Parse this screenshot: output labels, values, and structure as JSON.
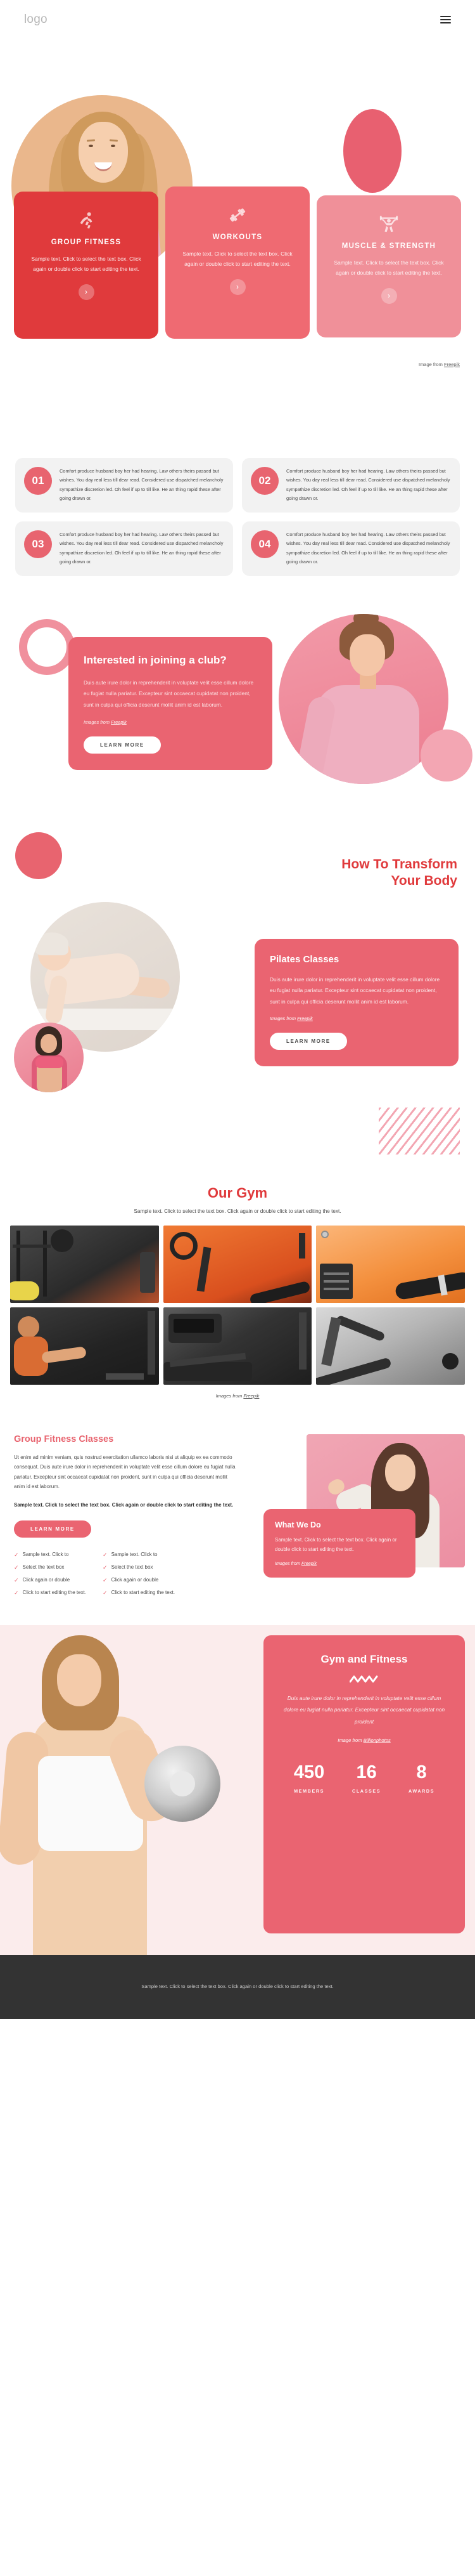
{
  "header": {
    "logo": "logo",
    "menu_icon": "hamburger-menu-icon"
  },
  "hero": {
    "cards": [
      {
        "icon": "stretching-person-icon",
        "title": "GROUP FITNESS",
        "body": "Sample text. Click to select the text box. Click again or double click to start editing the text.",
        "arrow": "›"
      },
      {
        "icon": "dumbbell-icon",
        "title": "WORKOUTS",
        "body": "Sample text. Click to select the text box. Click again or double click to start editing the text.",
        "arrow": "›"
      },
      {
        "icon": "weightlifter-icon",
        "title": "MUSCLE & STRENGTH",
        "body": "Sample text. Click to select the text box. Click again or double click to start editing the text.",
        "arrow": "›"
      }
    ],
    "credit_prefix": "Image from ",
    "credit_link": "Freepik"
  },
  "features": {
    "items": [
      {
        "number": "01",
        "body": "Comfort produce husband boy her had hearing. Law others theirs passed but wishes. You day real less till dear read. Considered use dispatched melancholy sympathize discretion led. Oh feel if up to till like. He an thing rapid these after going drawn or."
      },
      {
        "number": "02",
        "body": "Comfort produce husband boy her had hearing. Law others theirs passed but wishes. You day real less till dear read. Considered use dispatched melancholy sympathize discretion led. Oh feel if up to till like. He an thing rapid these after going drawn or."
      },
      {
        "number": "03",
        "body": "Comfort produce husband boy her had hearing. Law others theirs passed but wishes. You day real less till dear read. Considered use dispatched melancholy sympathize discretion led. Oh feel if up to till like. He an thing rapid these after going drawn or."
      },
      {
        "number": "04",
        "body": "Comfort produce husband boy her had hearing. Law others theirs passed but wishes. You day real less till dear read. Considered use dispatched melancholy sympathize discretion led. Oh feel if up to till like. He an thing rapid these after going drawn or."
      }
    ]
  },
  "join_club": {
    "title": "Interested in joining a club?",
    "body": "Duis aute irure dolor in reprehenderit in voluptate velit esse cillum dolore eu fugiat nulla pariatur. Excepteur sint occaecat cupidatat non proident, sunt in culpa qui officia deserunt mollit anim id est laborum.",
    "credit_prefix": "Images from ",
    "credit_link": "Freepik",
    "button": "LEARN MORE"
  },
  "transform": {
    "title_line1": "How To Transform",
    "title_line2": "Your Body",
    "card": {
      "title": "Pilates Classes",
      "body": "Duis aute irure dolor in reprehenderit in voluptate velit esse cillum dolore eu fugiat nulla pariatur. Excepteur sint occaecat cupidatat non proident, sunt in culpa qui officia deserunt mollit anim id est laborum.",
      "credit_prefix": "Images from ",
      "credit_link": "Freepik",
      "button": "LEARN MORE"
    }
  },
  "gallery": {
    "title": "Our Gym",
    "subtitle": "Sample text. Click to select the text box. Click again or double click to start editing the text.",
    "credit_prefix": "Images from ",
    "credit_link": "Freepik",
    "tiles": [
      {
        "alt": "gym-weight-rack-photo"
      },
      {
        "alt": "gym-exercise-bike-photo"
      },
      {
        "alt": "gym-bench-orange-wall-photo"
      },
      {
        "alt": "gym-leg-press-photo"
      },
      {
        "alt": "gym-treadmill-photo"
      },
      {
        "alt": "gym-incline-bench-photo"
      }
    ]
  },
  "group_classes": {
    "title": "Group Fitness Classes",
    "body": "Ut enim ad minim veniam, quis nostrud exercitation ullamco laboris nisi ut aliquip ex ea commodo consequat. Duis aute irure dolor in reprehenderit in voluptate velit esse cillum dolore eu fugiat nulla pariatur. Excepteur sint occaecat cupidatat non proident, sunt in culpa qui officia deserunt mollit anim id est laborum.",
    "bold_text": "Sample text. Click to select the text box. Click again or double click to start editing the text.",
    "button": "LEARN MORE",
    "list_left": [
      "Sample text. Click to",
      "Select the text box",
      "Click again or double",
      "Click to start editing the text."
    ],
    "list_right": [
      "Sample text. Click to",
      "Select the text box",
      "Click again or double",
      "Click to start editing the text."
    ],
    "card": {
      "title": "What We Do",
      "body": "Sample text. Click to select the text box. Click again or double click to start editing the text.",
      "credit_prefix": "Images from ",
      "credit_link": "Freepik"
    }
  },
  "banner": {
    "title": "Gym and Fitness",
    "divider_icon": "zigzag-divider-icon",
    "body": "Duis aute irure dolor in reprehenderit in voluptate velit esse cillum dolore eu fugiat nulla pariatur. Excepteur sint occaecat cupidatat non proident",
    "credit_prefix": "Image from ",
    "credit_link": "Billionphotos",
    "stats": [
      {
        "number": "450",
        "label": "MEMBERS"
      },
      {
        "number": "16",
        "label": "CLASSES"
      },
      {
        "number": "8",
        "label": "AWARDS"
      }
    ]
  },
  "footer": {
    "text": "Sample text. Click to select the text box. Click again or double click to start editing the text."
  },
  "colors": {
    "primary_red": "#e03a3c",
    "accent_coral": "#ea6471",
    "accent_pink": "#f09099",
    "light_pink": "#f3a6b3",
    "peach": "#eab78c",
    "footer_dark": "#333333",
    "panel_gray": "#f2f2f2"
  }
}
